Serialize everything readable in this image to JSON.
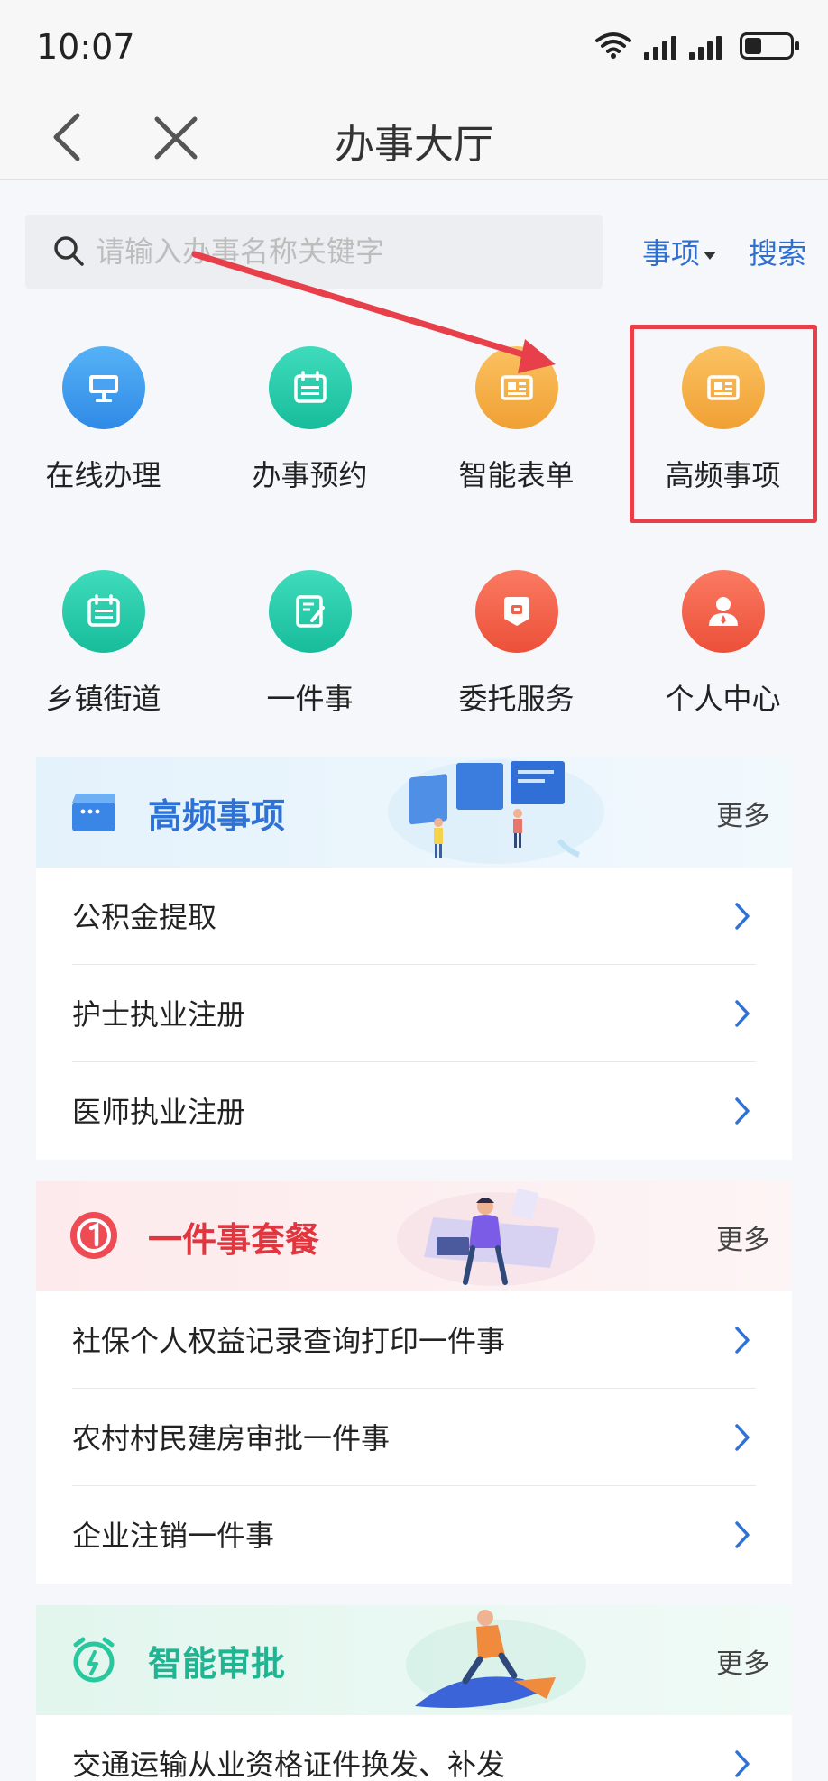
{
  "status_bar": {
    "time": "10:07"
  },
  "nav": {
    "title": "办事大厅"
  },
  "search": {
    "placeholder": "请输入办事名称关键字",
    "value": "",
    "scope_label": "事项",
    "button_label": "搜索"
  },
  "grid": [
    {
      "label": "在线办理",
      "icon": "monitor-icon",
      "color": "#3e9bf0"
    },
    {
      "label": "办事预约",
      "icon": "calendar-icon",
      "color": "#20c6a6"
    },
    {
      "label": "智能表单",
      "icon": "form-card-icon",
      "color": "#f5ad3e"
    },
    {
      "label": "高频事项",
      "icon": "form-card-icon",
      "color": "#f5ad3e"
    },
    {
      "label": "乡镇街道",
      "icon": "calendar-icon",
      "color": "#20c6a6"
    },
    {
      "label": "一件事",
      "icon": "edit-doc-icon",
      "color": "#20c6a6"
    },
    {
      "label": "委托服务",
      "icon": "badge-icon",
      "color": "#f2614a"
    },
    {
      "label": "个人中心",
      "icon": "person-icon",
      "color": "#f2614a"
    }
  ],
  "sections": [
    {
      "title": "高频事项",
      "title_color": "#2f72d6",
      "header_bg": "#e6f3fc",
      "more_label": "更多",
      "icon": "clapperboard-icon",
      "items": [
        "公积金提取",
        "护士执业注册",
        "医师执业注册"
      ]
    },
    {
      "title": "一件事套餐",
      "title_color": "#e2363f",
      "header_bg": "#fdeeef",
      "more_label": "更多",
      "icon": "number-one-badge-icon",
      "items": [
        "社保个人权益记录查询打印一件事",
        "农村村民建房审批一件事",
        "企业注销一件事"
      ]
    },
    {
      "title": "智能审批",
      "title_color": "#1fb593",
      "header_bg": "#e6f7f1",
      "more_label": "更多",
      "icon": "alarm-clock-icon",
      "items": [
        "交通运输从业资格证件换发、补发"
      ]
    }
  ],
  "colors": {
    "accent_blue": "#2f6fd0",
    "annotation_red": "#e8404a",
    "chevron_blue": "#2f72d6"
  }
}
